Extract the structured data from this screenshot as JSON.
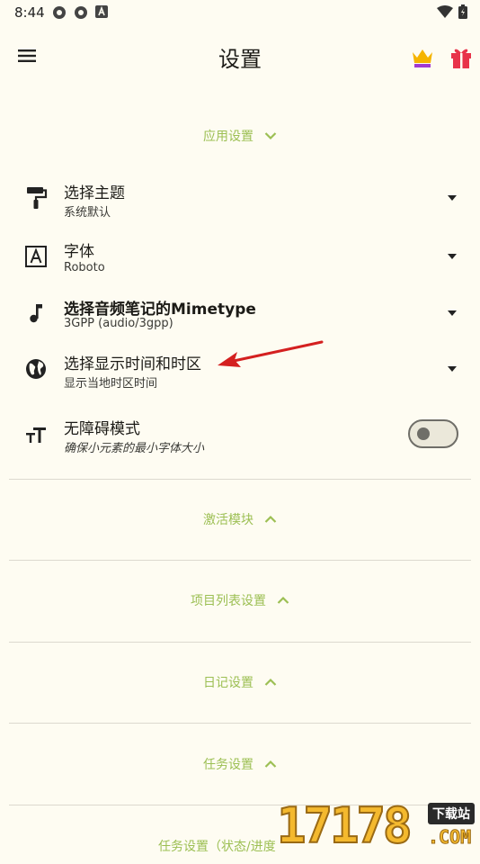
{
  "status_bar": {
    "time": "8:44"
  },
  "app_bar": {
    "title": "设置"
  },
  "sections": [
    {
      "label": "应用设置",
      "expanded": true
    },
    {
      "label": "激活模块",
      "expanded": false
    },
    {
      "label": "项目列表设置",
      "expanded": false
    },
    {
      "label": "日记设置",
      "expanded": false
    },
    {
      "label": "任务设置",
      "expanded": false
    },
    {
      "label": "任务设置（状态/进度",
      "expanded": false
    }
  ],
  "settings": [
    {
      "title": "选择主题",
      "subtitle": "系统默认",
      "icon": "paint-roller-icon"
    },
    {
      "title": "字体",
      "subtitle": "Roboto",
      "icon": "font-a-icon"
    },
    {
      "title": "选择音频笔记的Mimetype",
      "subtitle": "3GPP (audio/3gpp)",
      "icon": "music-note-icon"
    },
    {
      "title": "选择显示时间和时区",
      "subtitle": "显示当地时区时间",
      "icon": "globe-icon"
    },
    {
      "title": "无障碍模式",
      "subtitle": "确保小元素的最小字体大小",
      "icon": "text-size-icon",
      "toggle_on": false
    }
  ],
  "colors": {
    "accent": "#9cbf53",
    "background": "#fefcf2",
    "annotation_arrow": "#d42020",
    "crown": "#f5b400",
    "gift": "#e8334a"
  },
  "watermark": {
    "digits": "17178",
    "tag": "下载站",
    "domain": ".COM"
  }
}
